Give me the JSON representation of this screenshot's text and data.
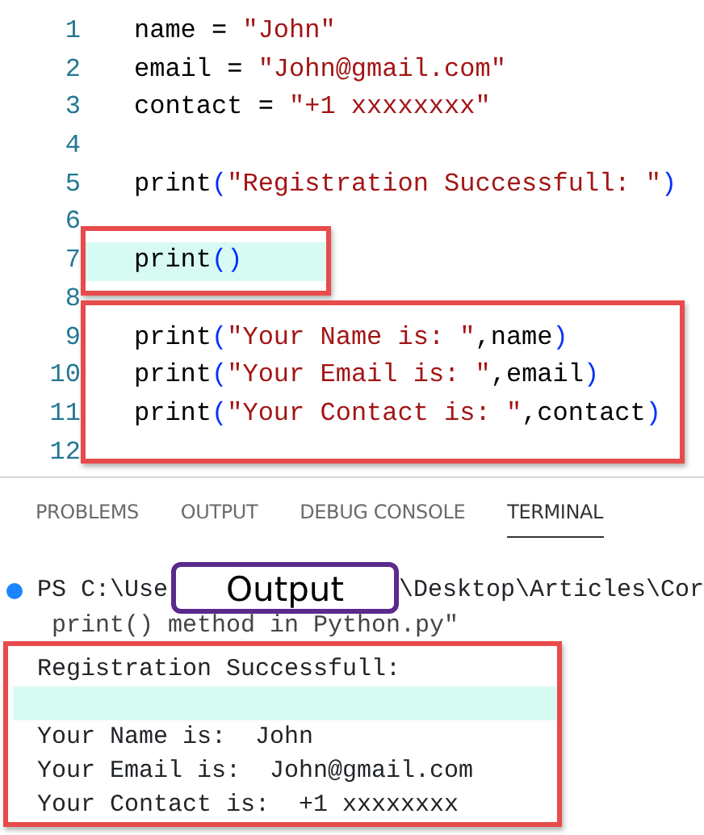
{
  "editor": {
    "lines": [
      {
        "number": "1",
        "tokens": [
          {
            "kind": "plain",
            "text": "name = "
          },
          {
            "kind": "string",
            "text": "\"John\""
          }
        ]
      },
      {
        "number": "2",
        "tokens": [
          {
            "kind": "plain",
            "text": "email = "
          },
          {
            "kind": "string",
            "text": "\"John@gmail.com\""
          }
        ]
      },
      {
        "number": "3",
        "tokens": [
          {
            "kind": "plain",
            "text": "contact = "
          },
          {
            "kind": "string",
            "text": "\"+1 xxxxxxxx\""
          }
        ]
      },
      {
        "number": "4"
      },
      {
        "number": "5",
        "tokens": [
          {
            "kind": "plain",
            "text": "print"
          },
          {
            "kind": "paren",
            "text": "("
          },
          {
            "kind": "string",
            "text": "\"Registration Successfull: \""
          },
          {
            "kind": "paren",
            "text": ")"
          }
        ]
      },
      {
        "number": "6"
      },
      {
        "number": "7",
        "highlighted": true,
        "framed": true,
        "new_frame": true,
        "tokens": [
          {
            "kind": "plain",
            "text": "print"
          },
          {
            "kind": "paren",
            "text": "()"
          }
        ]
      },
      {
        "number": "8",
        "framed": true,
        "new_frame": true
      },
      {
        "number": "9",
        "framed": true,
        "tokens": [
          {
            "kind": "plain",
            "text": "print"
          },
          {
            "kind": "paren",
            "text": "("
          },
          {
            "kind": "string",
            "text": "\"Your Name is: \""
          },
          {
            "kind": "plain",
            "text": ",name"
          },
          {
            "kind": "paren",
            "text": ")"
          }
        ]
      },
      {
        "number": "10",
        "framed": true,
        "tokens": [
          {
            "kind": "plain",
            "text": "print"
          },
          {
            "kind": "paren",
            "text": "("
          },
          {
            "kind": "string",
            "text": "\"Your Email is: \""
          },
          {
            "kind": "plain",
            "text": ",email"
          },
          {
            "kind": "paren",
            "text": ")"
          }
        ]
      },
      {
        "number": "11",
        "framed": true,
        "tokens": [
          {
            "kind": "plain",
            "text": "print"
          },
          {
            "kind": "paren",
            "text": "("
          },
          {
            "kind": "string",
            "text": "\"Your Contact is: \""
          },
          {
            "kind": "plain",
            "text": ",contact"
          },
          {
            "kind": "paren",
            "text": ")"
          }
        ]
      },
      {
        "number": "12",
        "framed": true
      }
    ]
  },
  "panel": {
    "tabs": [
      {
        "label": "PROBLEMS",
        "selected": false
      },
      {
        "label": "OUTPUT",
        "selected": false
      },
      {
        "label": "DEBUG CONSOLE",
        "selected": false
      },
      {
        "label": "TERMINAL",
        "selected": true
      }
    ]
  },
  "terminal": {
    "prompt_start": "PS C:\\Use",
    "prompt_end": "\\Desktop\\Articles\\Cor",
    "prompt_continuation": "print() method in Python.py\"",
    "output": [
      {
        "text": "Registration Successfull:",
        "framed": true
      },
      {
        "highlighted": true,
        "framed": true
      },
      {
        "text": "Your Name is:  John",
        "framed": true
      },
      {
        "text": "Your Email is:  John@gmail.com",
        "framed": true
      },
      {
        "text": "Your Contact is:  +1 xxxxxxxx",
        "framed": true
      }
    ]
  },
  "callout": {
    "label": "Output"
  }
}
